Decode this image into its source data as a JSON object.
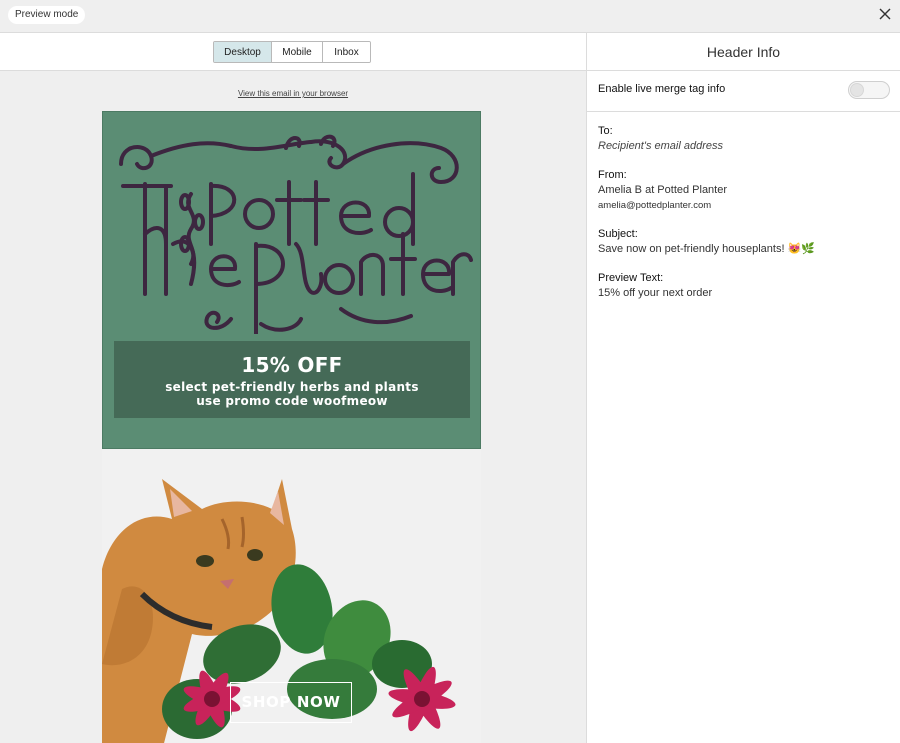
{
  "topbar": {
    "mode_label": "Preview mode",
    "close_icon": "close-icon"
  },
  "preview": {
    "view_options": [
      "Desktop",
      "Mobile",
      "Inbox"
    ],
    "active_view": "Desktop",
    "browser_link": "View this email in your browser",
    "email": {
      "logo_alt": "The Potted Planter",
      "promo_title": "15% OFF",
      "promo_line1": "select pet-friendly herbs and plants",
      "promo_line2_prefix": "use promo code ",
      "promo_code": "woofmeow",
      "cta": "SHOP NOW",
      "colors": {
        "hero_bg": "#5b8d74",
        "promo_bg": "#456a57",
        "logo_ink": "#3d2640"
      }
    }
  },
  "panel": {
    "title": "Header Info",
    "merge_toggle_label": "Enable live merge tag info",
    "merge_toggle_on": false,
    "fields": {
      "to_label": "To:",
      "to_value": "Recipient's email address",
      "from_label": "From:",
      "from_name": "Amelia B at Potted Planter",
      "from_email": "amelia@pottedplanter.com",
      "subject_label": "Subject:",
      "subject_value": "Save now on pet-friendly houseplants! 😻🌿",
      "preview_label": "Preview Text:",
      "preview_value": "15% off your next order"
    }
  }
}
